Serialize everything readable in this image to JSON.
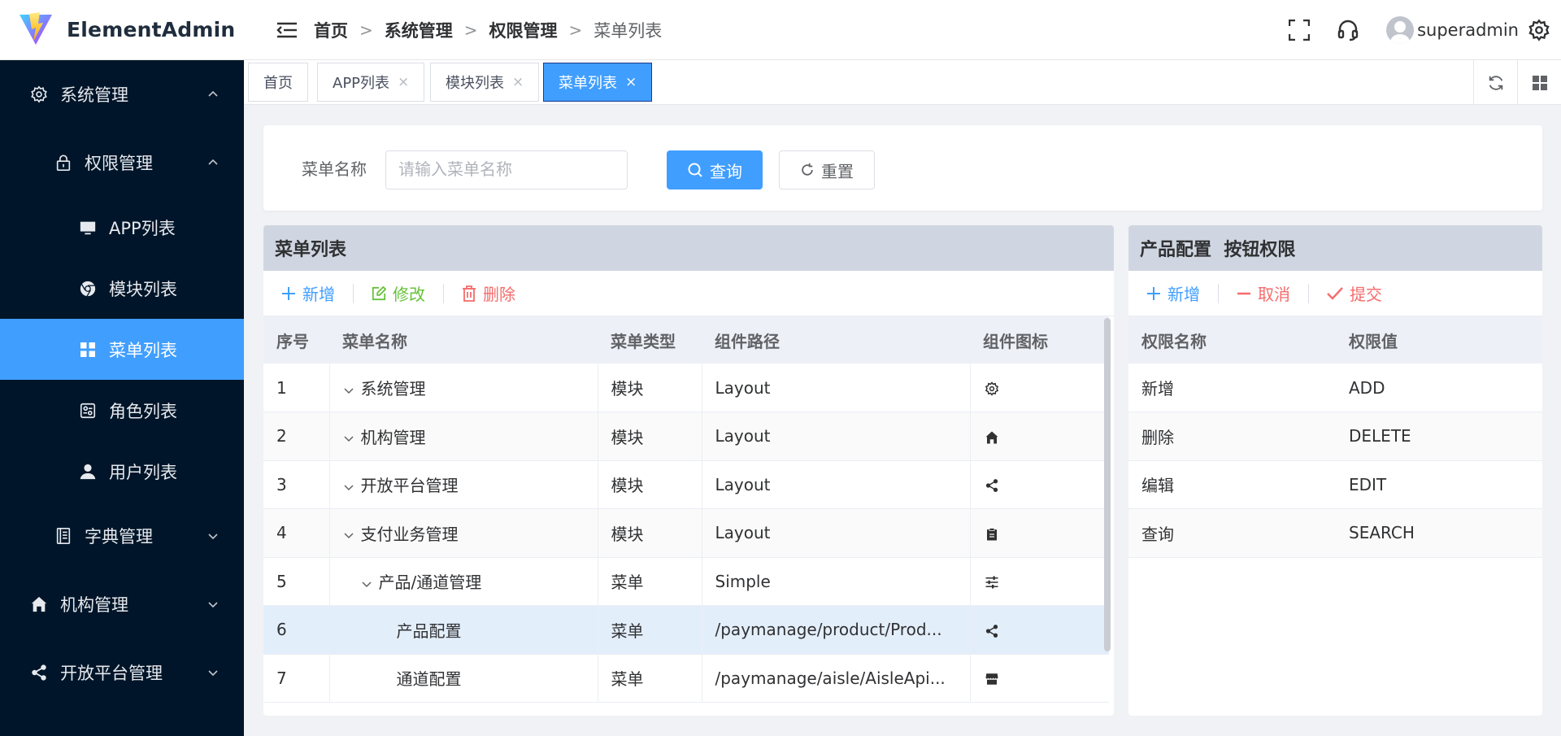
{
  "header": {
    "app_name": "ElementAdmin",
    "breadcrumb": [
      "首页",
      "系统管理",
      "权限管理",
      "菜单列表"
    ],
    "username": "superadmin"
  },
  "sidebar": {
    "items": [
      {
        "label": "系统管理",
        "icon": "gear-icon",
        "level": 1,
        "arrow": "up"
      },
      {
        "label": "权限管理",
        "icon": "lock-icon",
        "level": 2,
        "arrow": "up"
      },
      {
        "label": "APP列表",
        "icon": "monitor-icon",
        "level": 3
      },
      {
        "label": "模块列表",
        "icon": "chrome-icon",
        "level": 3
      },
      {
        "label": "菜单列表",
        "icon": "grid-icon",
        "level": 3,
        "active": true
      },
      {
        "label": "角色列表",
        "icon": "role-icon",
        "level": 3
      },
      {
        "label": "用户列表",
        "icon": "user-icon",
        "level": 3
      },
      {
        "label": "字典管理",
        "icon": "book-icon",
        "level": 2,
        "arrow": "down"
      },
      {
        "label": "机构管理",
        "icon": "home-icon",
        "level": 1,
        "arrow": "down"
      },
      {
        "label": "开放平台管理",
        "icon": "share-icon",
        "level": 1,
        "arrow": "down"
      }
    ]
  },
  "tabs": [
    {
      "label": "首页",
      "closable": false
    },
    {
      "label": "APP列表",
      "closable": true
    },
    {
      "label": "模块列表",
      "closable": true
    },
    {
      "label": "菜单列表",
      "closable": true,
      "active": true
    }
  ],
  "tab_close_glyph": "×",
  "search": {
    "label": "菜单名称",
    "placeholder": "请输入菜单名称",
    "query_label": "查询",
    "reset_label": "重置"
  },
  "menu_panel": {
    "title": "菜单列表",
    "add_label": "新增",
    "edit_label": "修改",
    "delete_label": "删除",
    "columns": [
      "序号",
      "菜单名称",
      "菜单类型",
      "组件路径",
      "组件图标"
    ],
    "rows": [
      {
        "index": "1",
        "name": "系统管理",
        "type": "模块",
        "path": "Layout",
        "icon": "gear-icon",
        "depth": 0,
        "expanded": true
      },
      {
        "index": "2",
        "name": "机构管理",
        "type": "模块",
        "path": "Layout",
        "icon": "home-icon",
        "depth": 0,
        "expanded": true
      },
      {
        "index": "3",
        "name": "开放平台管理",
        "type": "模块",
        "path": "Layout",
        "icon": "share-icon",
        "depth": 0,
        "expanded": true
      },
      {
        "index": "4",
        "name": "支付业务管理",
        "type": "模块",
        "path": "Layout",
        "icon": "clipboard-icon",
        "depth": 0,
        "expanded": true
      },
      {
        "index": "5",
        "name": "产品/通道管理",
        "type": "菜单",
        "path": "Simple",
        "icon": "sliders-icon",
        "depth": 1,
        "expanded": true
      },
      {
        "index": "6",
        "name": "产品配置",
        "type": "菜单",
        "path": "/paymanage/product/Prod...",
        "icon": "share-icon",
        "depth": 2,
        "selected": true
      },
      {
        "index": "7",
        "name": "通道配置",
        "type": "菜单",
        "path": "/paymanage/aisle/AisleApi...",
        "icon": "shop-icon",
        "depth": 2
      }
    ]
  },
  "perm_panel": {
    "title": "产品配置  按钮权限",
    "add_label": "新增",
    "cancel_label": "取消",
    "submit_label": "提交",
    "columns": [
      "权限名称",
      "权限值"
    ],
    "rows": [
      {
        "name": "新增",
        "value": "ADD"
      },
      {
        "name": "删除",
        "value": "DELETE"
      },
      {
        "name": "编辑",
        "value": "EDIT"
      },
      {
        "name": "查询",
        "value": "SEARCH"
      }
    ]
  },
  "colors": {
    "primary": "#409eff",
    "sidebar_bg": "#001529",
    "success": "#67c23a",
    "danger": "#f56c6c"
  }
}
